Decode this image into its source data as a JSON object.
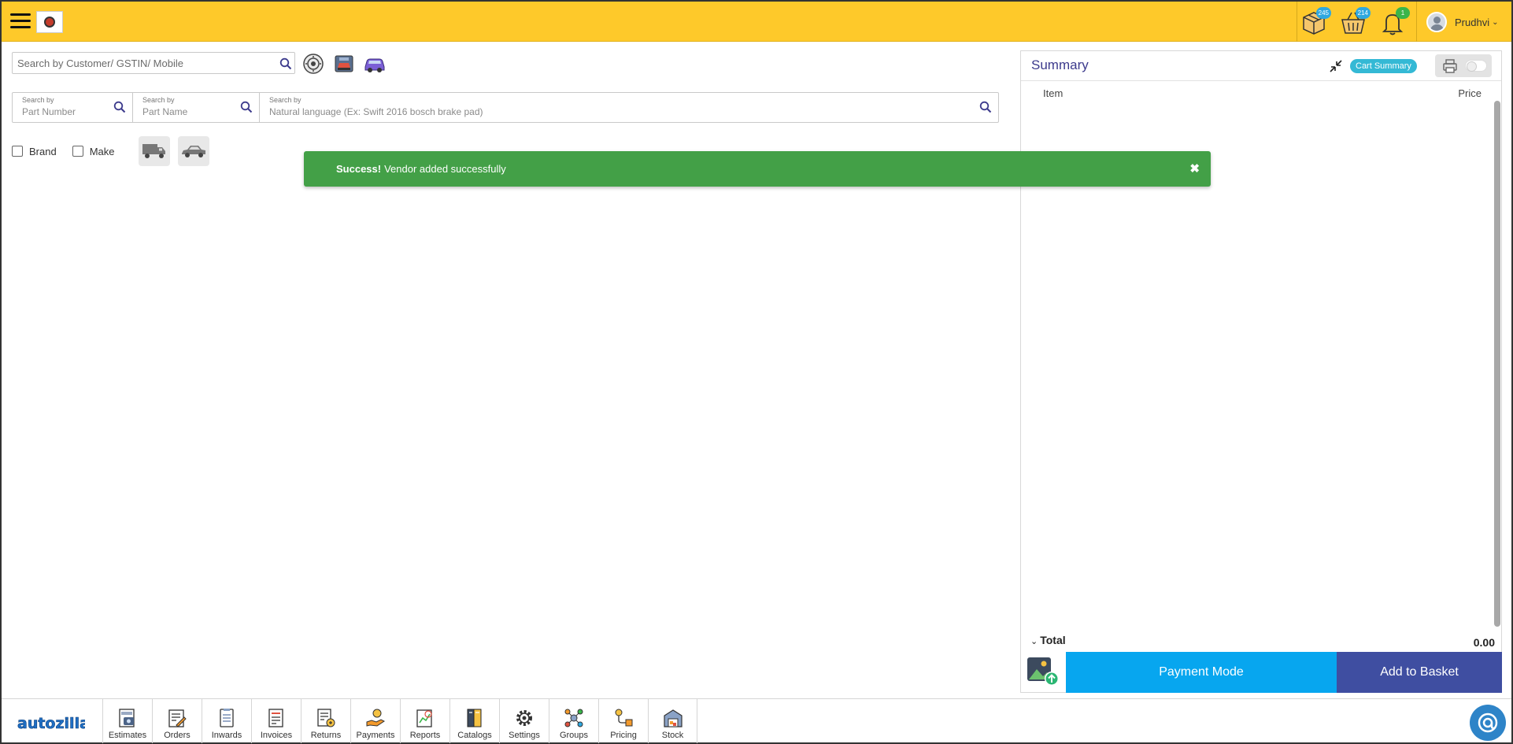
{
  "header": {
    "user_name": "Prudhvi",
    "badges": {
      "orders": "245",
      "basket": "214",
      "notifications": "1"
    },
    "colors": {
      "bar": "#fec92a",
      "orders_badge": "#2ea8e0",
      "basket_badge": "#2ea8e0",
      "notif_badge": "#3ab54a"
    }
  },
  "search": {
    "customer_placeholder": "Search by Customer/ GSTIN/ Mobile",
    "part_number_label": "Search by",
    "part_number_placeholder": "Part Number",
    "part_name_label": "Search by",
    "part_name_placeholder": "Part Name",
    "natural_label": "Search by",
    "natural_placeholder": "Natural language (Ex: Swift 2016 bosch brake pad)"
  },
  "filters": {
    "brand_label": "Brand",
    "make_label": "Make"
  },
  "toast": {
    "strong": "Success!",
    "message": "Vendor added successfully",
    "close": "✖",
    "color": "#43a047"
  },
  "summary": {
    "title": "Summary",
    "cart_summary_label": "Cart Summary",
    "col_item": "Item",
    "col_price": "Price",
    "total_label": "Total",
    "total_caret": "⌄",
    "total_value": "0.00",
    "payment_mode_label": "Payment Mode",
    "add_to_basket_label": "Add to Basket"
  },
  "bottom_nav": {
    "brand": "autozilla",
    "items": [
      {
        "label": "Estimates",
        "icon": "estimates-icon"
      },
      {
        "label": "Orders",
        "icon": "orders-icon"
      },
      {
        "label": "Inwards",
        "icon": "inwards-icon"
      },
      {
        "label": "Invoices",
        "icon": "invoices-icon"
      },
      {
        "label": "Returns",
        "icon": "returns-icon"
      },
      {
        "label": "Payments",
        "icon": "payments-icon"
      },
      {
        "label": "Reports",
        "icon": "reports-icon"
      },
      {
        "label": "Catalogs",
        "icon": "catalogs-icon"
      },
      {
        "label": "Settings",
        "icon": "settings-icon"
      },
      {
        "label": "Groups",
        "icon": "groups-icon"
      },
      {
        "label": "Pricing",
        "icon": "pricing-icon"
      },
      {
        "label": "Stock",
        "icon": "stock-icon"
      }
    ]
  }
}
